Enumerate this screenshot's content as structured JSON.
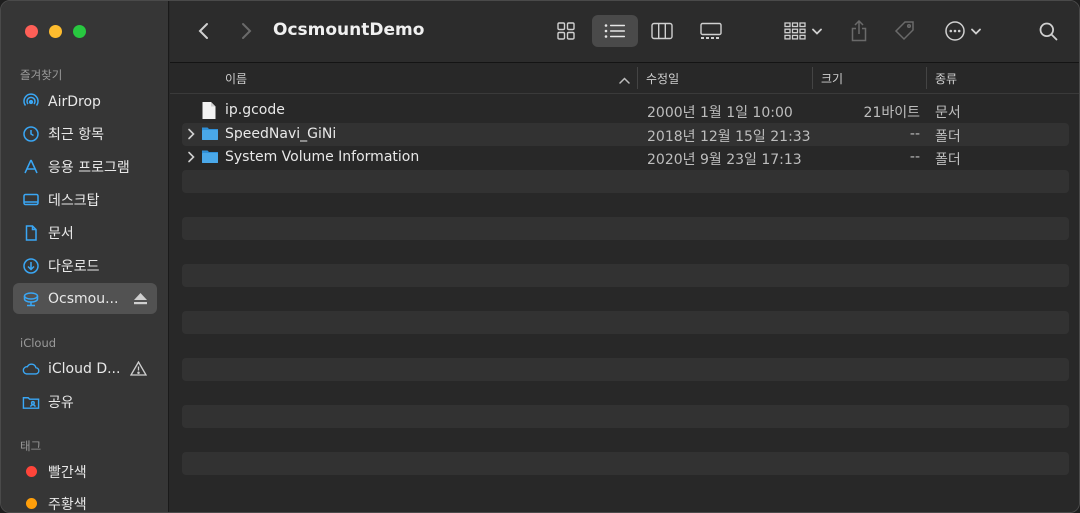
{
  "sidebar": {
    "favorites_label": "즐겨찾기",
    "favorites": [
      {
        "label": "AirDrop",
        "icon": "airdrop-icon"
      },
      {
        "label": "최근 항목",
        "icon": "clock-icon"
      },
      {
        "label": "응용 프로그램",
        "icon": "applications-icon"
      },
      {
        "label": "데스크탑",
        "icon": "desktop-icon"
      },
      {
        "label": "문서",
        "icon": "document-icon"
      },
      {
        "label": "다운로드",
        "icon": "download-icon"
      },
      {
        "label": "Ocsmou...",
        "icon": "network-drive-icon",
        "selected": true
      }
    ],
    "icloud_label": "iCloud",
    "icloud": [
      {
        "label": "iCloud D...",
        "icon": "icloud-icon"
      },
      {
        "label": "공유",
        "icon": "shared-folder-icon"
      }
    ],
    "tags_label": "태그",
    "tags": [
      {
        "label": "빨간색",
        "color": "#ff453a"
      },
      {
        "label": "주황색",
        "color": "#ff9f0a"
      }
    ]
  },
  "toolbar": {
    "title": "OcsmountDemo"
  },
  "columns": {
    "name": "이름",
    "date": "수정일",
    "size": "크기",
    "kind": "종류"
  },
  "files": [
    {
      "name": "ip.gcode",
      "date": "2000년 1월 1일 10:00",
      "size": "21바이트",
      "kind": "문서",
      "type": "file"
    },
    {
      "name": "SpeedNavi_GiNi",
      "date": "2018년 12월 15일 21:33",
      "size": "--",
      "kind": "폴더",
      "type": "folder"
    },
    {
      "name": "System Volume Information",
      "date": "2020년 9월 23일 17:13",
      "size": "--",
      "kind": "폴더",
      "type": "folder"
    }
  ],
  "colors": {
    "accent": "#3aa7f5",
    "selected_bg": "#525252",
    "folder": "#4aa8e8"
  }
}
